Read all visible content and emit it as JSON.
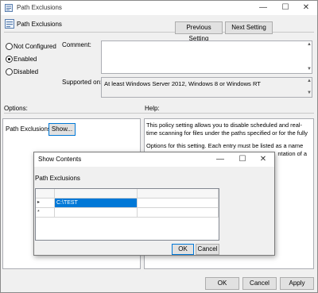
{
  "window": {
    "title": "Path Exclusions",
    "setting_name": "Path Exclusions",
    "min_glyph": "—",
    "max_glyph": "☐",
    "close_glyph": "✕"
  },
  "nav": {
    "previous_label": "Previous Setting",
    "next_label": "Next Setting"
  },
  "state": {
    "options": [
      "Not Configured",
      "Enabled",
      "Disabled"
    ],
    "selected": "Enabled"
  },
  "comment": {
    "label": "Comment:",
    "value": ""
  },
  "supported": {
    "label": "Supported on:",
    "value": "At least Windows Server 2012, Windows 8 or Windows RT"
  },
  "options_section": {
    "label": "Options:",
    "field_label": "Path Exclusions",
    "show_button": "Show..."
  },
  "help_section": {
    "label": "Help:",
    "para1": "This policy setting allows you to disable scheduled and real-time scanning for files under the paths specified or for the fully",
    "para2": "Options for this setting. Each entry must be listed as a name",
    "para2_tail": "ntation of a"
  },
  "footer": {
    "ok_label": "OK",
    "cancel_label": "Cancel",
    "apply_label": "Apply"
  },
  "show_contents": {
    "title": "Show Contents",
    "subtitle": "Path Exclusions",
    "rows": [
      {
        "marker": "▸",
        "value": "C:\\TEST"
      },
      {
        "marker": "*",
        "value": ""
      }
    ],
    "ok_label": "OK",
    "cancel_label": "Cancel",
    "min_glyph": "—",
    "max_glyph": "☐",
    "close_glyph": "✕"
  }
}
